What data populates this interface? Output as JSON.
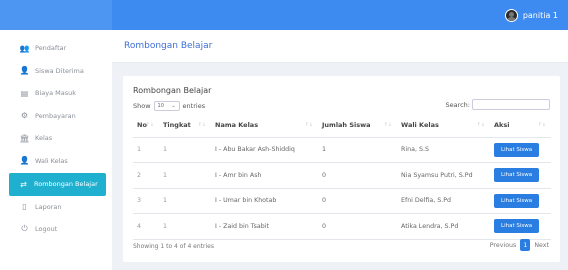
{
  "header_bar": {
    "user_name": "panitia 1"
  },
  "sidebar": {
    "items": [
      {
        "label": "Pendaftar",
        "icon": "users-icon",
        "glyph": "👥"
      },
      {
        "label": "Siswa Diterima",
        "icon": "user-check-icon",
        "glyph": "👤"
      },
      {
        "label": "Biaya Masuk",
        "icon": "table-icon",
        "glyph": "▤"
      },
      {
        "label": "Pembayaran",
        "icon": "payment-icon",
        "glyph": "⚙"
      },
      {
        "label": "Kelas",
        "icon": "building-icon",
        "glyph": "🏛"
      },
      {
        "label": "Wali Kelas",
        "icon": "person-icon",
        "glyph": "👤"
      },
      {
        "label": "Rombongan Belajar",
        "icon": "group-icon",
        "glyph": "⇄",
        "active": true
      },
      {
        "label": "Laporan",
        "icon": "document-icon",
        "glyph": "▯"
      },
      {
        "label": "Logout",
        "icon": "power-icon",
        "glyph": "⏻"
      }
    ]
  },
  "page": {
    "title": "Rombongan Belajar"
  },
  "card": {
    "title": "Rombongan Belajar",
    "show_label": "Show",
    "entries_value": "10",
    "entries_label": "entries",
    "search_label": "Search:"
  },
  "table": {
    "headers": [
      "No",
      "Tingkat",
      "Nama Kelas",
      "Jumlah Siswa",
      "Wali Kelas",
      "Aksi"
    ],
    "rows": [
      {
        "no": "1",
        "tingkat": "1",
        "nama_kelas": "I - Abu Bakar Ash-Shiddiq",
        "jumlah": "1",
        "wali": "Rina, S.S",
        "aksi": "Lihat Siswa"
      },
      {
        "no": "2",
        "tingkat": "1",
        "nama_kelas": "I - Amr bin Ash",
        "jumlah": "0",
        "wali": "Nia Syamsu Putri, S.Pd",
        "aksi": "Lihat Siswa"
      },
      {
        "no": "3",
        "tingkat": "1",
        "nama_kelas": "I - Umar bin Khotab",
        "jumlah": "0",
        "wali": "Efni Delfia, S.Pd",
        "aksi": "Lihat Siswa"
      },
      {
        "no": "4",
        "tingkat": "1",
        "nama_kelas": "I - Zaid bin Tsabit",
        "jumlah": "0",
        "wali": "Atika Lendra, S.Pd",
        "aksi": "Lihat Siswa"
      }
    ]
  },
  "footer": {
    "info": "Showing 1 to 4 of 4 entries",
    "previous": "Previous",
    "current_page": "1",
    "next": "Next"
  },
  "colors": {
    "topbar": "#3d8bf0",
    "active_nav": "#1fb0d0",
    "button": "#2a7de1",
    "page_title": "#3d6fd6"
  }
}
